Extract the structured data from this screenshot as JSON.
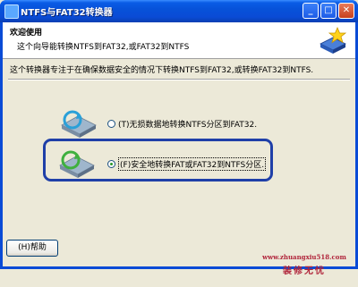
{
  "window": {
    "title": "NTFS与FAT32转换器"
  },
  "header": {
    "title": "欢迎使用",
    "subtitle": "这个向导能转换NTFS到FAT32,或FAT32到NTFS"
  },
  "description": "这个转换器专注于在确保数据安全的情况下转换NTFS到FAT32,或转换FAT32到NTFS.",
  "options": [
    {
      "label": "(T)无损数据地转换NTFS分区到FAT32.",
      "checked": false,
      "icon": "ntfs-to-fat32-disk-icon"
    },
    {
      "label": "(F)安全地转换FAT或FAT32到NTFS分区.",
      "checked": true,
      "icon": "fat32-to-ntfs-disk-icon"
    }
  ],
  "help_button": {
    "label": "(H)帮助"
  },
  "watermark": {
    "url": "www.zhuangxiu518.com",
    "name": "装修无忧"
  },
  "colors": {
    "titlebar": "#0a4bd6",
    "highlight_border": "#1f3fa8",
    "watermark": "#b0243a"
  }
}
